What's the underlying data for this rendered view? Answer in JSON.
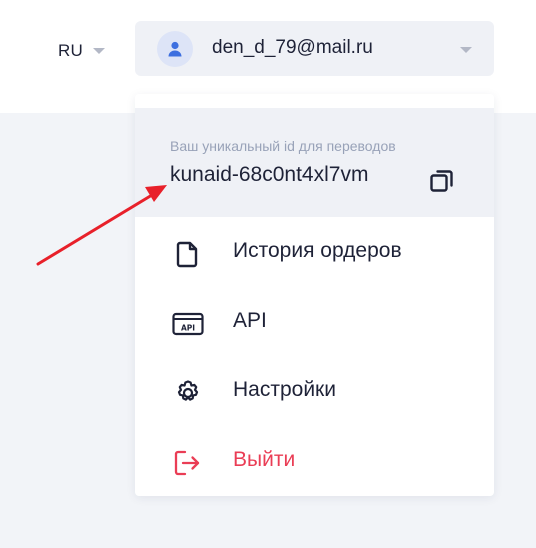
{
  "header": {
    "language": {
      "code": "RU",
      "icon": "chevron-down-icon"
    },
    "account": {
      "email": "den_d_79@mail.ru",
      "avatar_icon": "user-icon",
      "toggle_icon": "chevron-down-icon"
    }
  },
  "dropdown": {
    "id_caption": "Ваш уникальный id для переводов",
    "id_value": "kunaid-68c0nt4xl7vm",
    "copy_icon": "copy-icon",
    "items": [
      {
        "label": "История ордеров",
        "icon": "document-icon"
      },
      {
        "label": "API",
        "icon": "api-icon"
      },
      {
        "label": "Настройки",
        "icon": "gear-icon"
      },
      {
        "label": "Выйти",
        "icon": "logout-icon"
      }
    ]
  },
  "colors": {
    "text": "#1e2237",
    "muted": "#98a2b8",
    "panel": "#eff1f6",
    "background": "#f2f4f8",
    "danger": "#ea3d55",
    "avatar_bg": "#dde4f7",
    "avatar_fg": "#3d6fe0",
    "annotation_arrow": "#e8202a"
  }
}
